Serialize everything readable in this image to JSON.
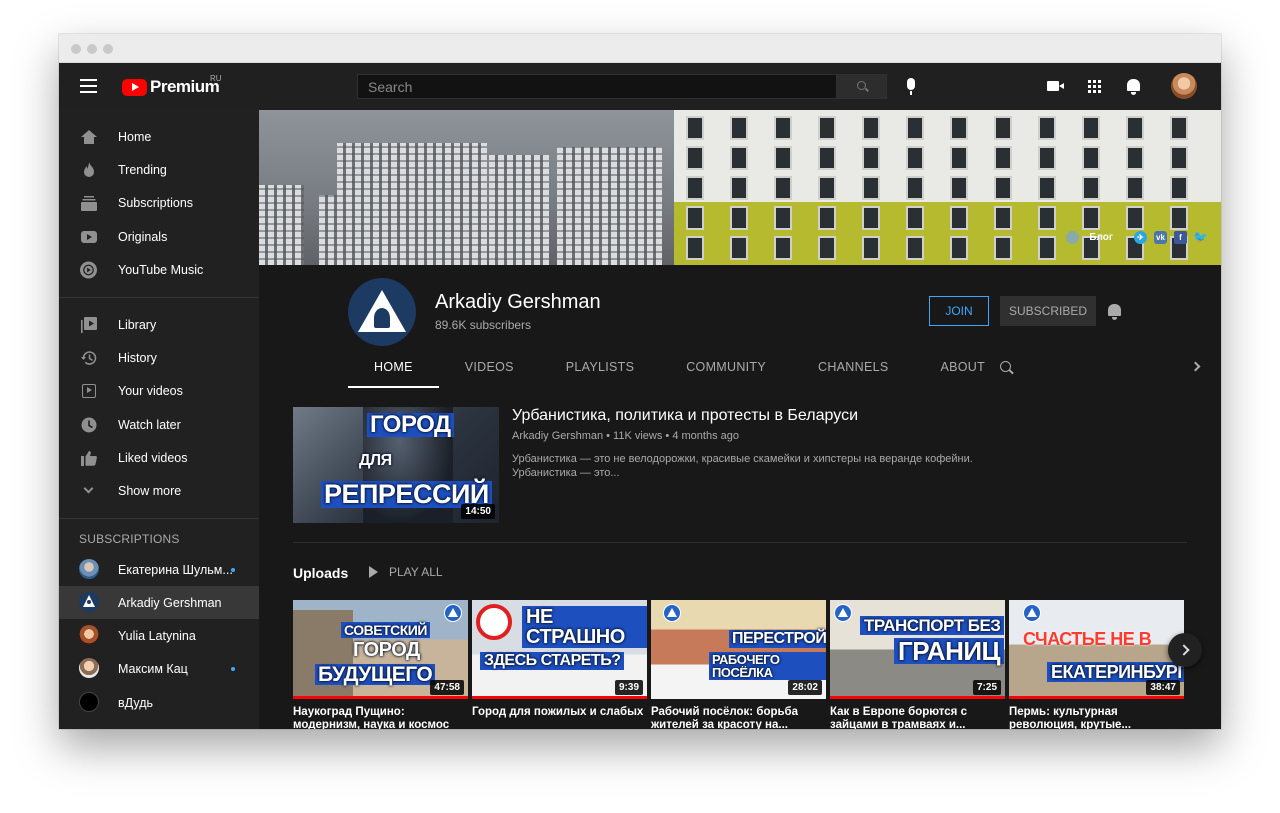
{
  "header": {
    "logo_text": "Premium",
    "logo_region": "RU",
    "search_placeholder": "Search"
  },
  "sidebar": {
    "main_items": [
      {
        "label": "Home",
        "icon": "home-icon"
      },
      {
        "label": "Trending",
        "icon": "fire-icon"
      },
      {
        "label": "Subscriptions",
        "icon": "subscriptions-icon"
      },
      {
        "label": "Originals",
        "icon": "originals-icon"
      },
      {
        "label": "YouTube Music",
        "icon": "music-icon"
      }
    ],
    "library_items": [
      {
        "label": "Library",
        "icon": "library-icon"
      },
      {
        "label": "History",
        "icon": "history-icon"
      },
      {
        "label": "Your videos",
        "icon": "your-videos-icon"
      },
      {
        "label": "Watch later",
        "icon": "clock-icon"
      },
      {
        "label": "Liked videos",
        "icon": "thumbs-up-icon"
      },
      {
        "label": "Show more",
        "icon": "chevron-down-icon"
      }
    ],
    "subscriptions_title": "SUBSCRIPTIONS",
    "subscriptions": [
      {
        "name": "Екатерина Шульм...",
        "new": true
      },
      {
        "name": "Arkadiy Gershman",
        "new": false,
        "active": true
      },
      {
        "name": "Yulia Latynina",
        "new": false
      },
      {
        "name": "Максим Кац",
        "new": true
      },
      {
        "name": "вДудь",
        "new": false
      }
    ]
  },
  "banner": {
    "links_label": "Блог",
    "social_icons": [
      "telegram-icon",
      "vk-icon",
      "facebook-icon",
      "twitter-icon"
    ]
  },
  "channel": {
    "name": "Arkadiy Gershman",
    "subscribers": "89.6K subscribers",
    "join_label": "JOIN",
    "subscribed_label": "SUBSCRIBED",
    "tabs": [
      "HOME",
      "VIDEOS",
      "PLAYLISTS",
      "COMMUNITY",
      "CHANNELS",
      "ABOUT"
    ]
  },
  "featured": {
    "title": "Урбанистика, политика и протесты в Беларуси",
    "meta": "Arkadiy Gershman • 11K views • 4 months ago",
    "description": "Урбанистика — это не велодорожки, красивые скамейки и хипстеры на веранде кофейни. Урбанистика — это...",
    "duration": "14:50",
    "thumb_lines": [
      "ГОРОД",
      "ДЛЯ",
      "РЕПРЕССИЙ"
    ]
  },
  "uploads": {
    "title": "Uploads",
    "play_all": "PLAY ALL",
    "items": [
      {
        "title": "Наукоград Пущино: модернизм, наука и космос",
        "duration": "47:58",
        "thumb_lines": [
          "СОВЕТСКИЙ",
          "ГОРОД",
          "БУДУЩЕГО"
        ],
        "watched": 1.0
      },
      {
        "title": "Город для пожилых и слабых",
        "duration": "9:39",
        "thumb_lines": [
          "НЕ СТРАШНО",
          "ЗДЕСЬ СТАРЕТЬ?"
        ],
        "watched": 1.0
      },
      {
        "title": "Рабочий посёлок: борьба жителей за красоту на...",
        "duration": "28:02",
        "thumb_lines": [
          "ПЕРЕСТРОЙКА",
          "РАБОЧЕГО ПОСЁЛКА"
        ],
        "watched": 0.0
      },
      {
        "title": "Как в Европе борются с зайцами в трамваях и...",
        "duration": "7:25",
        "thumb_lines": [
          "ТРАНСПОРТ БЕЗ",
          "ГРАНИЦ"
        ],
        "watched": 1.0
      },
      {
        "title": "Пермь: культурная революция, крутые...",
        "duration": "38:47",
        "thumb_lines": [
          "СЧАСТЬЕ НЕ В",
          "ЕКАТЕРИНБУРГЕ"
        ],
        "watched": 1.0
      }
    ]
  },
  "colors": {
    "accent": "#3ea6ff",
    "brand_red": "#ff0000",
    "background": "#181818",
    "sidebar": "#212121"
  }
}
